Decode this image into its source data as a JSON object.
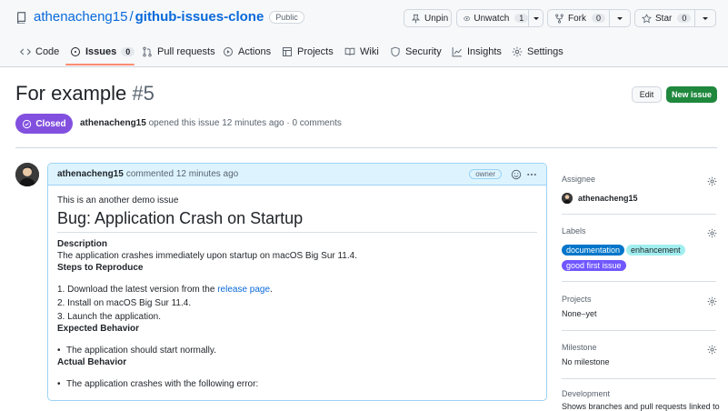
{
  "repo": {
    "owner": "athenacheng15",
    "separator": "/",
    "name": "github-issues-clone",
    "visibility": "Public"
  },
  "actions": {
    "unpin": "Unpin",
    "unwatch": "Unwatch",
    "unwatch_count": "1",
    "fork": "Fork",
    "fork_count": "0",
    "star": "Star",
    "star_count": "0"
  },
  "tabs": [
    {
      "label": "Code",
      "icon": "code-icon"
    },
    {
      "label": "Issues",
      "icon": "issue-opened-icon",
      "count": "0",
      "active": true
    },
    {
      "label": "Pull requests",
      "icon": "git-pull-request-icon"
    },
    {
      "label": "Actions",
      "icon": "play-icon"
    },
    {
      "label": "Projects",
      "icon": "table-icon"
    },
    {
      "label": "Wiki",
      "icon": "book-icon"
    },
    {
      "label": "Security",
      "icon": "shield-icon"
    },
    {
      "label": "Insights",
      "icon": "graph-icon"
    },
    {
      "label": "Settings",
      "icon": "gear-icon"
    }
  ],
  "issue": {
    "title": "For example",
    "number": "#5",
    "edit_label": "Edit",
    "new_issue_label": "New issue",
    "state": "Closed",
    "author": "athenacheng15",
    "opened_text": "opened this issue 12 minutes ago · 0 comments"
  },
  "comment": {
    "author": "athenacheng15",
    "time": "commented 12 minutes ago",
    "role": "owner",
    "intro": "This is an another demo issue",
    "heading": "Bug: Application Crash on Startup",
    "description_h": "Description",
    "description": "The application crashes immediately upon startup on macOS Big Sur 11.4.",
    "steps_h": "Steps to Reproduce",
    "step1_pre": "1. Download the latest version from the",
    "step1_link": "release page",
    "step1_post": ".",
    "step2": "2. Install on macOS Big Sur 11.4.",
    "step3": "3. Launch the application.",
    "expected_h": "Expected Behavior",
    "expected": "The application should start normally.",
    "actual_h": "Actual Behavior",
    "actual": "The application crashes with the following error:"
  },
  "sidebar": {
    "assignee_title": "Assignee",
    "assignee_name": "athenacheng15",
    "labels_title": "Labels",
    "labels": [
      {
        "text": "documentation",
        "bg": "#0075ca",
        "fg": "#ffffff"
      },
      {
        "text": "enhancement",
        "bg": "#a2eeef",
        "fg": "#1f2328"
      },
      {
        "text": "good first issue",
        "bg": "#7057ff",
        "fg": "#ffffff"
      }
    ],
    "projects_title": "Projects",
    "projects_value": "None–yet",
    "milestone_title": "Milestone",
    "milestone_value": "No milestone",
    "development_title": "Development",
    "development_value": "Shows branches and pull requests linked to"
  },
  "colors": {
    "accent": "#0969da",
    "closed": "#8250df",
    "new_issue": "#1f883d",
    "tab_underline": "#fd8c73"
  }
}
